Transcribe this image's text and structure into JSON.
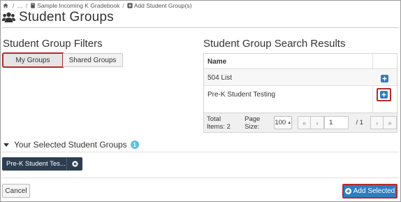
{
  "breadcrumb": {
    "items": [
      "…",
      "Sample Incoming K Gradebook",
      "Add Student Group(s)"
    ],
    "separator": "/"
  },
  "page": {
    "title": "Student Groups"
  },
  "filters": {
    "heading": "Student Group Filters",
    "tabs": [
      {
        "label": "My Groups",
        "active": true
      },
      {
        "label": "Shared Groups",
        "active": false
      }
    ]
  },
  "results": {
    "heading": "Student Group Search Results",
    "column_header": "Name",
    "rows": [
      {
        "name": "504 List"
      },
      {
        "name": "Pre-K Student Testing"
      }
    ],
    "pager": {
      "total_label": "Total Items: 2",
      "page_size_label": "Page Size:",
      "page_size_value": "100",
      "current_page": "1",
      "of_pages": "/ 1",
      "first_symbol": "«",
      "prev_symbol": "‹",
      "next_symbol": "›",
      "last_symbol": "»"
    }
  },
  "selected": {
    "heading": "Your Selected Student Groups",
    "count": "1",
    "chips": [
      {
        "label": "Pre-K Student Tes..."
      }
    ]
  },
  "footer": {
    "cancel_label": "Cancel",
    "add_selected_label": "Add Selected"
  },
  "colors": {
    "accent": "#2f7dc1",
    "highlight_border": "#b42a2a",
    "chip_bg": "#2c3e50",
    "badge": "#5bc0de"
  }
}
